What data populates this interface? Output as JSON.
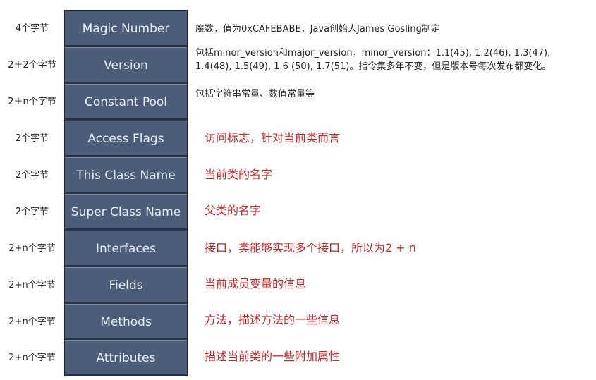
{
  "rows": [
    {
      "size": "4个字节",
      "name": "Magic Number",
      "desc": [
        "魔数，值为0xCAFEBABE，Java创始人James Gosling制定"
      ],
      "desc_style": "black"
    },
    {
      "size": "2＋2个字节",
      "name": "Version",
      "desc": [
        "包括minor_version和major_version，minor_version：1.1(45), 1.2(46), 1.3(47),",
        "1.4(48), 1.5(49), 1.6 (50), 1.7(51)。指令集多年不变，但是版本号每次发布都变化。"
      ],
      "desc_style": "black"
    },
    {
      "size": "2＋n个字节",
      "name": "Constant Pool",
      "desc": [
        "包括字符串常量、数值常量等"
      ],
      "desc_style": "black"
    },
    {
      "size": "2个字节",
      "name": "Access Flags",
      "desc": [
        "访问标志，针对当前类而言"
      ],
      "desc_style": "red"
    },
    {
      "size": "2个字节",
      "name": "This Class Name",
      "desc": [
        "当前类的名字"
      ],
      "desc_style": "red"
    },
    {
      "size": "2个字节",
      "name": "Super Class Name",
      "desc": [
        "父类的名字"
      ],
      "desc_style": "red"
    },
    {
      "size": "2+n个字节",
      "name": "Interfaces",
      "desc": [
        "接口，类能够实现多个接口，所以为2 + n"
      ],
      "desc_style": "red"
    },
    {
      "size": "2+n个字节",
      "name": "Fields",
      "desc": [
        "当前成员变量的信息"
      ],
      "desc_style": "red"
    },
    {
      "size": "2+n个字节",
      "name": "Methods",
      "desc": [
        "方法，描述方法的一些信息"
      ],
      "desc_style": "red"
    },
    {
      "size": "2+n个字节",
      "name": "Attributes",
      "desc": [
        "描述当前类的一些附加属性"
      ],
      "desc_style": "red"
    }
  ],
  "colors": {
    "cell_fill": "#4b5d79",
    "cell_text": "#e9edf3",
    "annotation_red": "#cc2222",
    "annotation_black": "#222222"
  }
}
